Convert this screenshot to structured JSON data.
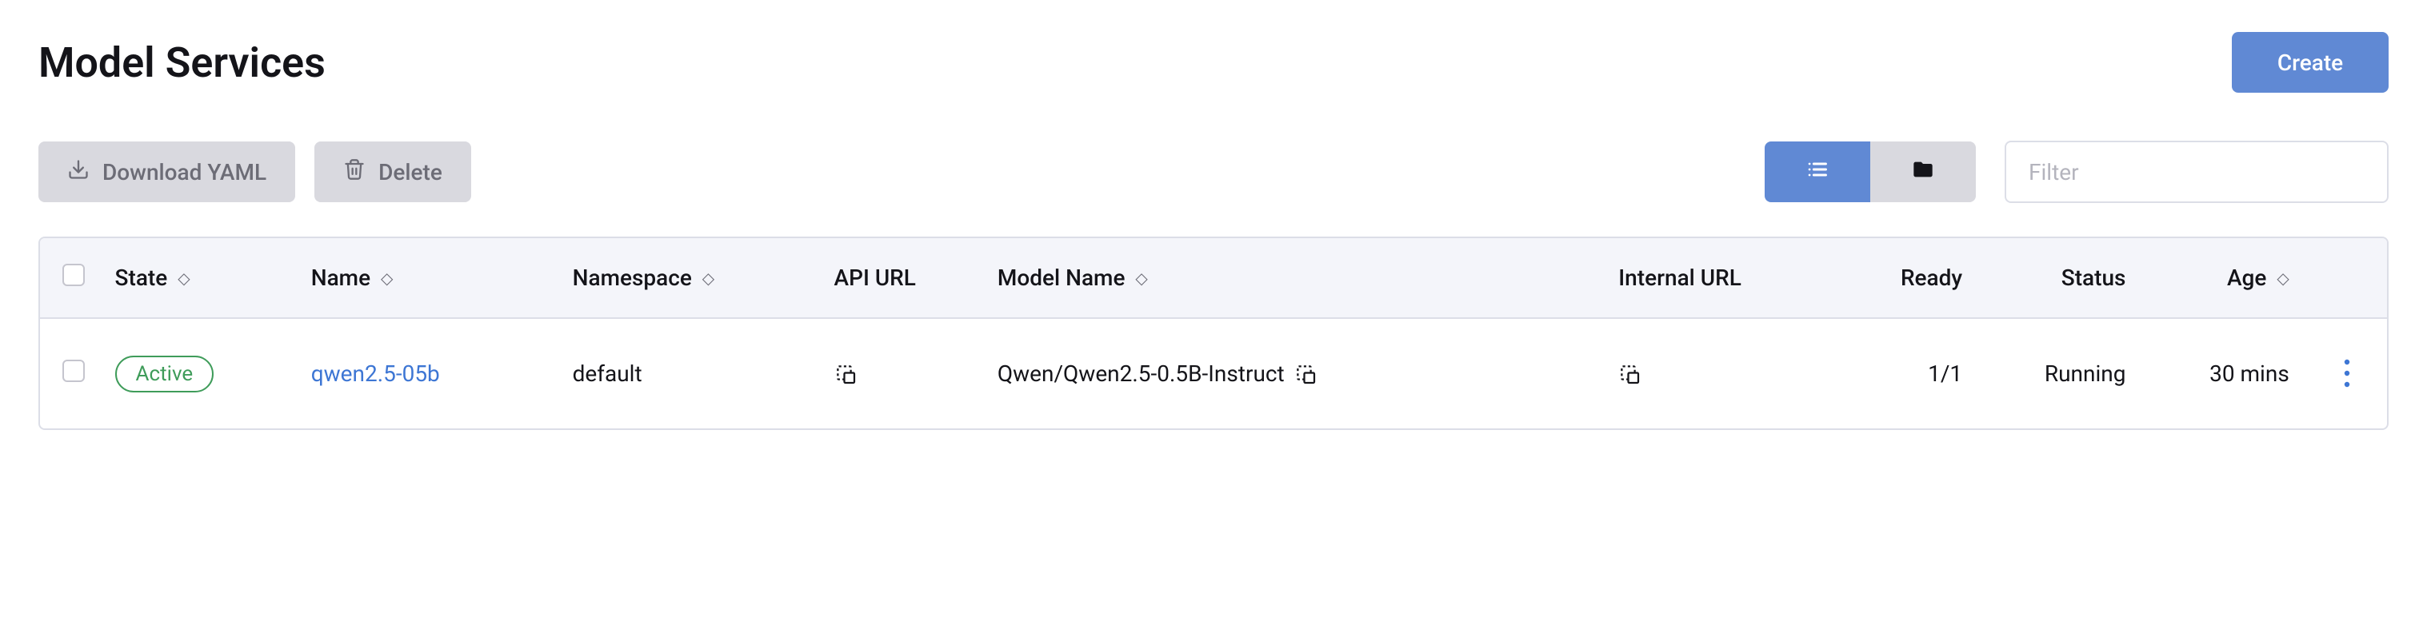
{
  "header": {
    "title": "Model Services",
    "create_label": "Create"
  },
  "toolbar": {
    "download_label": "Download YAML",
    "delete_label": "Delete",
    "filter_placeholder": "Filter"
  },
  "columns": {
    "state": "State",
    "name": "Name",
    "namespace": "Namespace",
    "api_url": "API URL",
    "model_name": "Model Name",
    "internal_url": "Internal URL",
    "ready": "Ready",
    "status": "Status",
    "age": "Age"
  },
  "rows": [
    {
      "state": "Active",
      "name": "qwen2.5-05b",
      "namespace": "default",
      "model_name": "Qwen/Qwen2.5-0.5B-Instruct",
      "ready": "1/1",
      "status": "Running",
      "age": "30 mins"
    }
  ]
}
